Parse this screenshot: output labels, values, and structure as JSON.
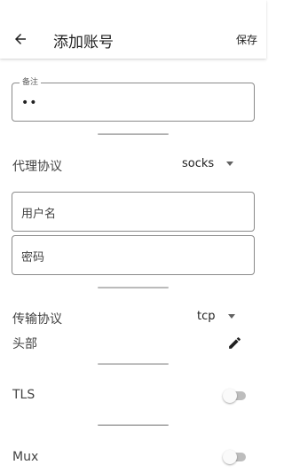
{
  "appbar": {
    "back_icon": "arrow-back-icon",
    "title": "添加账号",
    "save_label": "保存"
  },
  "remark_field": {
    "label": "备注",
    "value": "••"
  },
  "proxy_protocol": {
    "label": "代理协议",
    "selected": "socks"
  },
  "username_field": {
    "placeholder": "用户名"
  },
  "password_field": {
    "placeholder": "密码"
  },
  "transport_protocol": {
    "label": "传输协议",
    "selected": "tcp"
  },
  "header": {
    "label": "头部",
    "edit_icon": "pencil-icon"
  },
  "tls": {
    "label": "TLS",
    "enabled": false
  },
  "mux": {
    "label": "Mux",
    "enabled": false
  }
}
